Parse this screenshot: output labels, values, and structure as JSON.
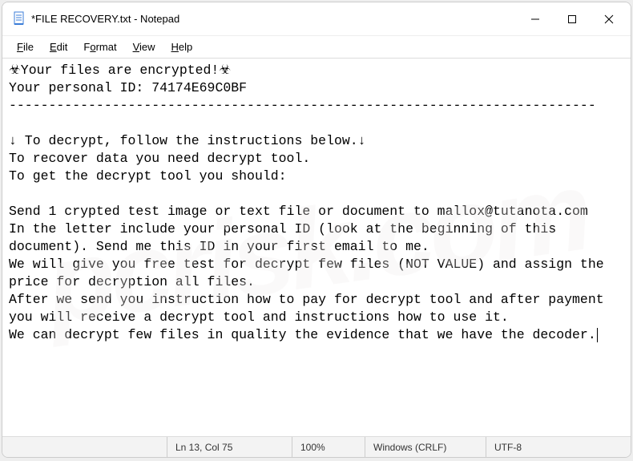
{
  "titlebar": {
    "title": "*FILE RECOVERY.txt - Notepad"
  },
  "menubar": {
    "items": [
      "File",
      "Edit",
      "Format",
      "View",
      "Help"
    ]
  },
  "body": {
    "line1_prefix": "☣",
    "line1_text": "Your files are encrypted!",
    "line1_suffix": "☣",
    "line2": "Your personal ID: 74174E69C0BF",
    "line3": "--------------------------------------------------------------------------",
    "line5": "↓ To decrypt, follow the instructions below.↓",
    "line6": "To recover data you need decrypt tool.",
    "line7": "To get the decrypt tool you should:",
    "line9": "Send 1 crypted test image or text file or document to mallox@tutanota.com",
    "line10": "In the letter include your personal ID (look at the beginning of this document). Send me this ID in your first email to me.",
    "line11": "We will give you free test for decrypt few files (NOT VALUE) and assign the price for decryption all files.",
    "line12": "After we send you instruction how to pay for decrypt tool and after payment you will receive a decrypt tool and instructions how to use it.",
    "line13": "We can decrypt few files in quality the evidence that we have the decoder."
  },
  "statusbar": {
    "position": "Ln 13, Col 75",
    "zoom": "100%",
    "eol": "Windows (CRLF)",
    "encoding": "UTF-8"
  },
  "watermark": "pcrisk.com"
}
